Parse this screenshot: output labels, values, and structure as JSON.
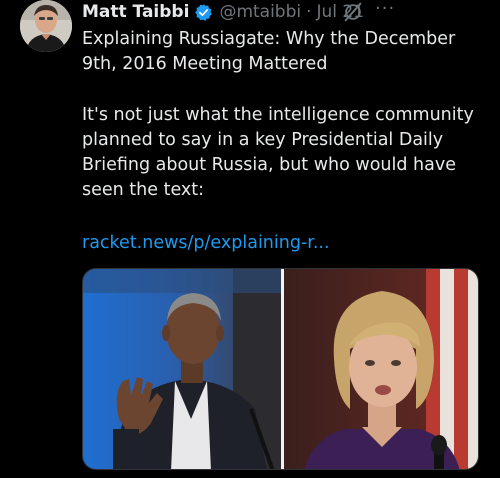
{
  "tweet": {
    "author_name": "Matt Taibbi",
    "handle": "@mtaibbi",
    "separator": "·",
    "date": "Jul 21",
    "more_label": "···",
    "title": "Explaining Russiagate: Why the December 9th, 2016 Meeting Mattered",
    "paragraph": "It's not just what the intelligence community planned to say in a key Presidential Daily Briefing about Russia, but who would have seen the text:",
    "link": "racket.news/p/explaining-r..."
  },
  "icons": {
    "verified": "verified-badge-icon",
    "grok": "grok-icon",
    "more": "more-options-icon"
  },
  "colors": {
    "background": "#000000",
    "text": "#e7e9ea",
    "muted": "#71767b",
    "link": "#1d9bf0",
    "verified": "#1d9bf0"
  }
}
